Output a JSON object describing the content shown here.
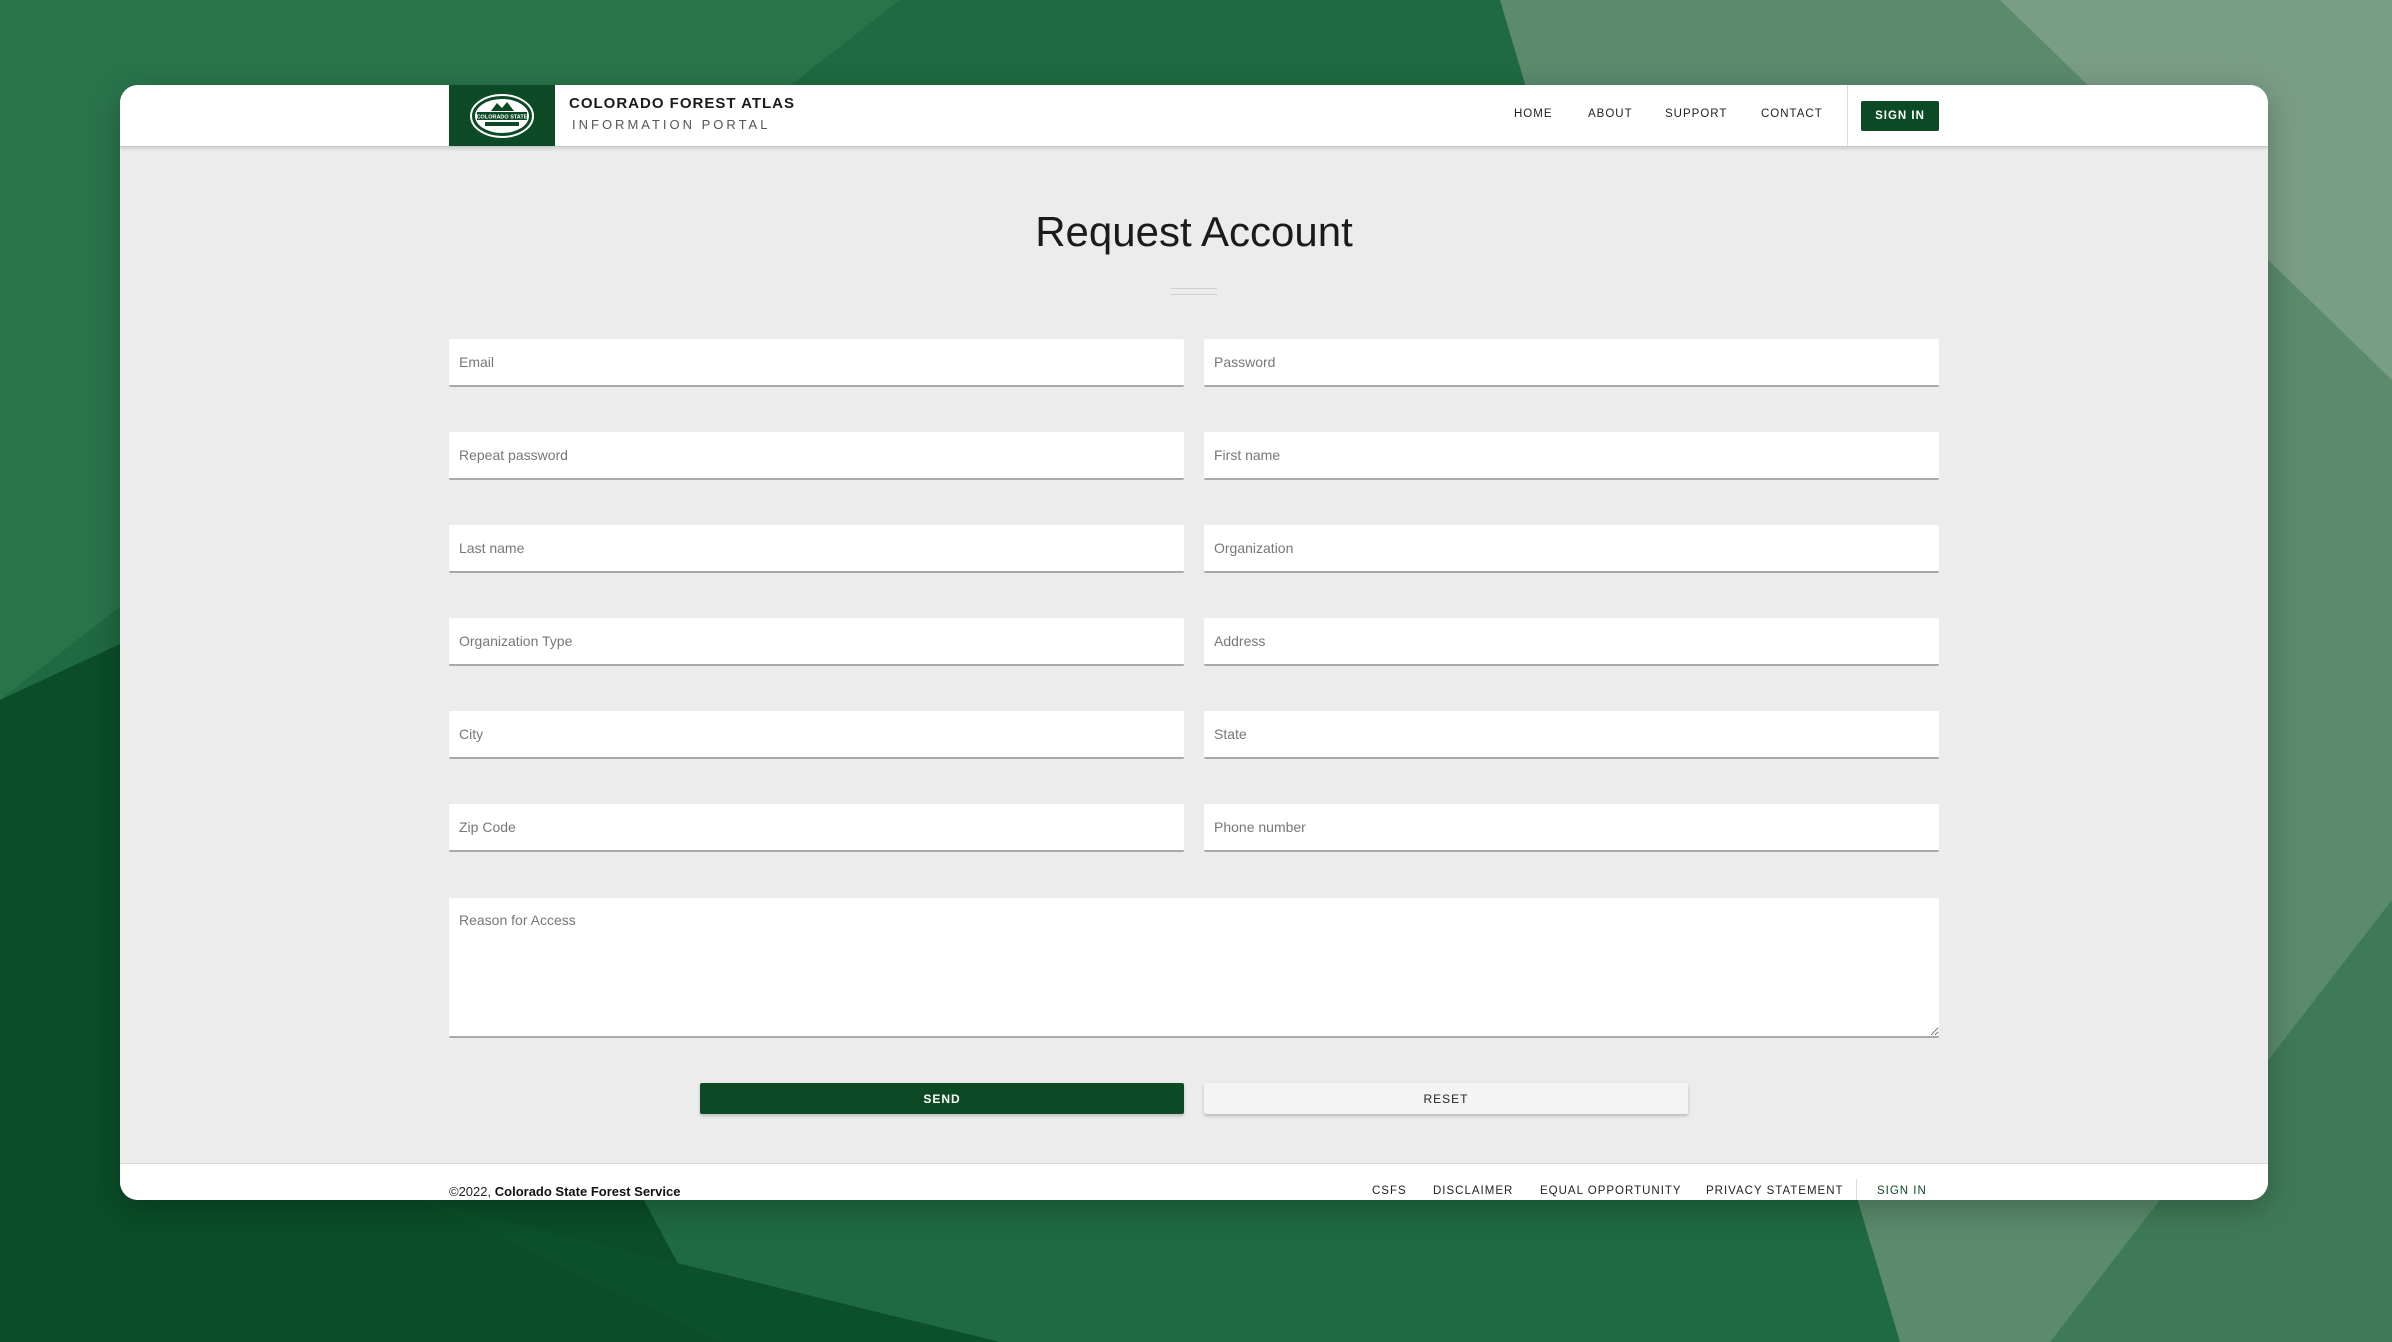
{
  "colors": {
    "brand_green": "#0c4a26",
    "page_bg": "#ececec",
    "header_bg": "#ffffff"
  },
  "header": {
    "logo_icon": "colorado-state-forest-service-logo",
    "logo_text": "COLORADO STATE",
    "title": "COLORADO FOREST ATLAS",
    "subtitle": "INFORMATION PORTAL",
    "nav": {
      "home": "HOME",
      "about": "ABOUT",
      "support": "SUPPORT",
      "contact": "CONTACT"
    },
    "signin_label": "SIGN IN"
  },
  "main": {
    "title": "Request Account",
    "fields": {
      "email": "Email",
      "password": "Password",
      "repeat_password": "Repeat password",
      "first_name": "First name",
      "last_name": "Last name",
      "organization": "Organization",
      "organization_type": "Organization Type",
      "address": "Address",
      "city": "City",
      "state": "State",
      "zip_code": "Zip Code",
      "phone_number": "Phone number",
      "reason": "Reason for Access"
    },
    "send_label": "SEND",
    "reset_label": "RESET"
  },
  "footer": {
    "copyright_prefix": "©2022,",
    "copyright_org": "Colorado State Forest Service",
    "links": {
      "csfs": "CSFS",
      "disclaimer": "DISCLAIMER",
      "equal_opportunity": "EQUAL OPPORTUNITY",
      "privacy": "PRIVACY STATEMENT",
      "signin": "SIGN IN"
    }
  }
}
